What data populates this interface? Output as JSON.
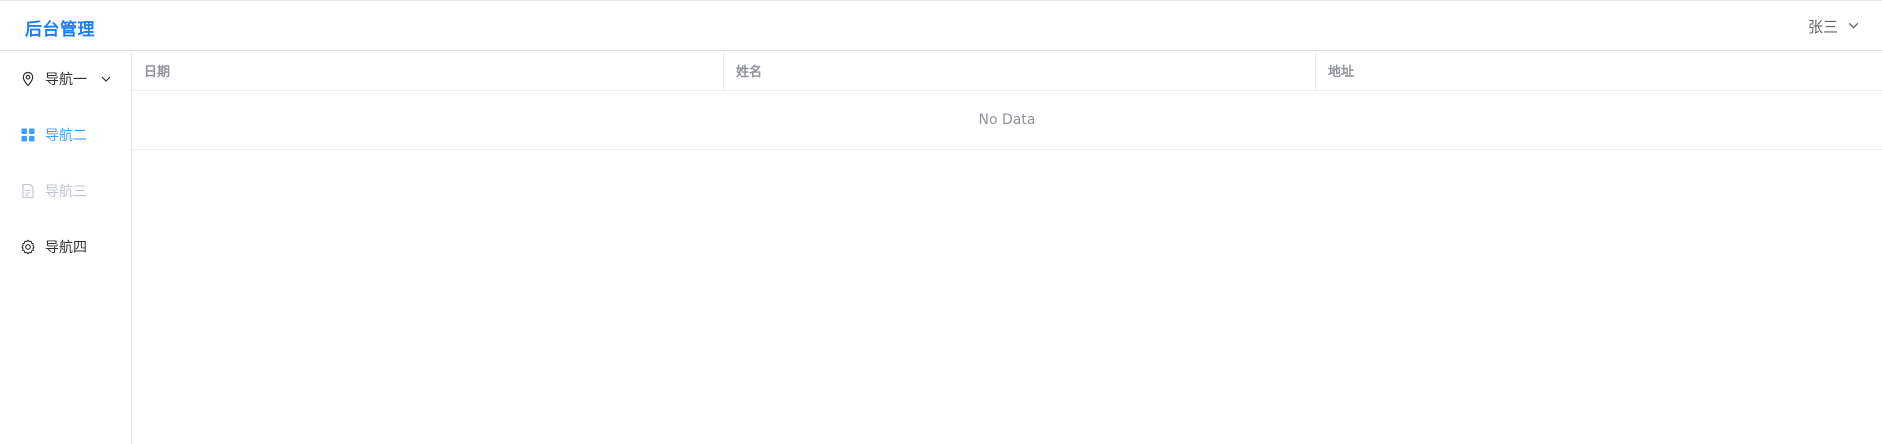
{
  "header": {
    "brand": "后台管理",
    "user_name": "张三"
  },
  "sidebar": {
    "items": [
      {
        "label": "导航一",
        "icon": "location-icon",
        "has_submenu": true
      },
      {
        "label": "导航二",
        "icon": "menu-grid-icon",
        "active": true
      },
      {
        "label": "导航三",
        "icon": "document-icon",
        "disabled": true
      },
      {
        "label": "导航四",
        "icon": "gear-icon"
      }
    ]
  },
  "table": {
    "columns": [
      "日期",
      "姓名",
      "地址"
    ],
    "rows": [],
    "empty_text": "No Data"
  },
  "colors": {
    "accent": "#409eff",
    "brand": "#1e7ff0",
    "disabled": "#c0c4cc",
    "muted": "#909399",
    "border": "#ebeef5"
  }
}
